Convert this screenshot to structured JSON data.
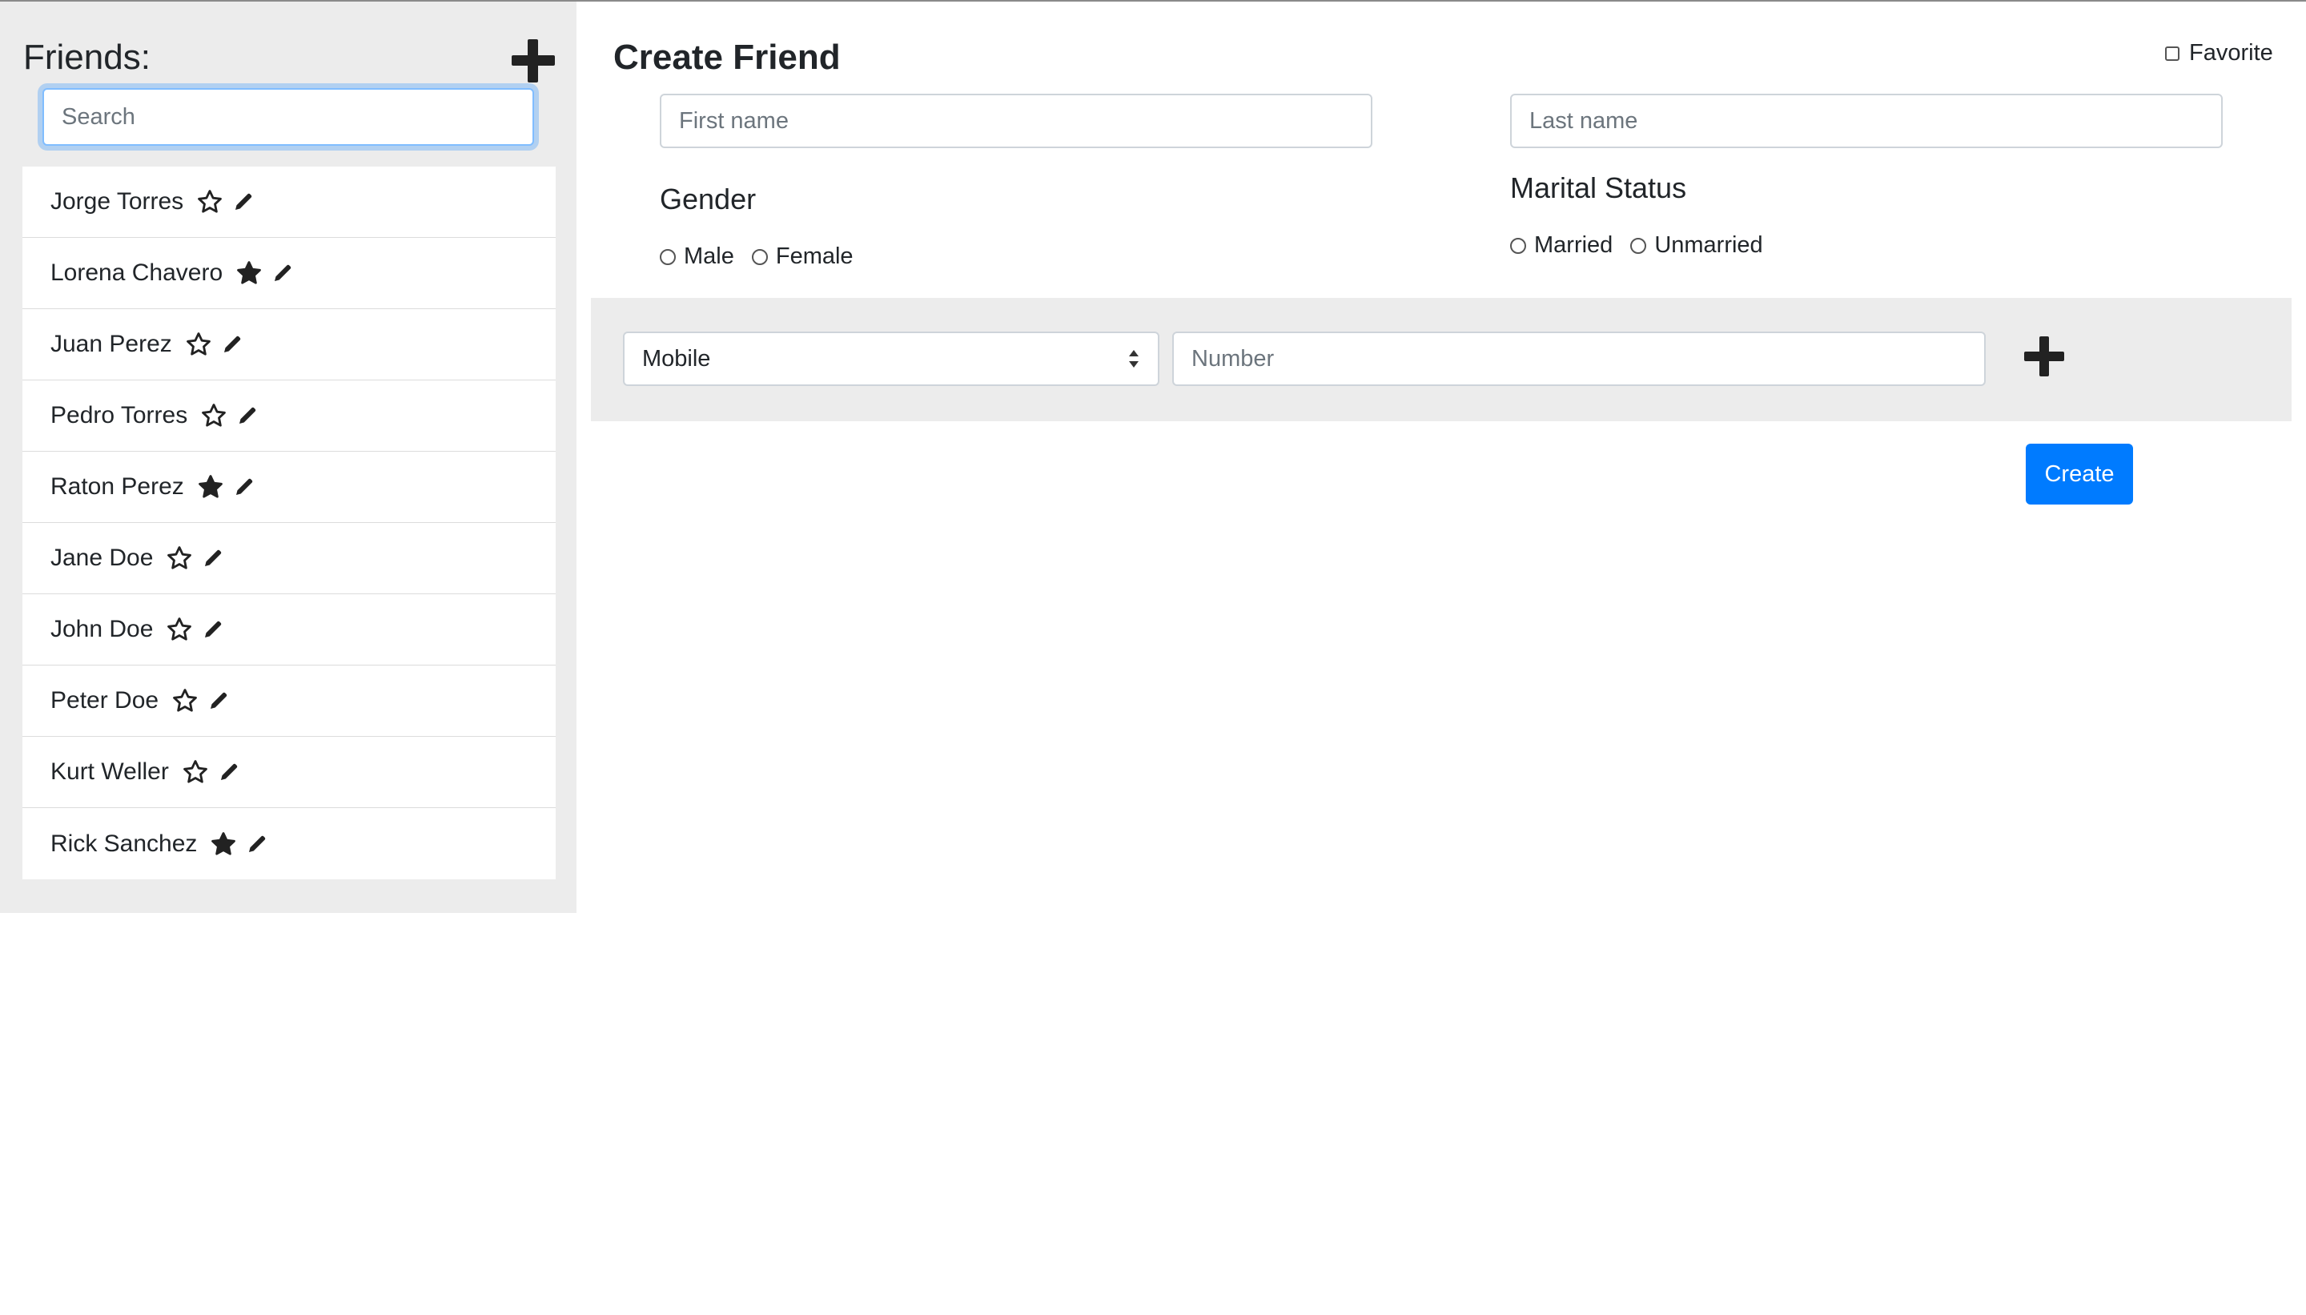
{
  "sidebar": {
    "title": "Friends:",
    "add_icon": "plus-icon",
    "search": {
      "placeholder": "Search",
      "value": ""
    },
    "friends": [
      {
        "name": "Jorge Torres",
        "favorite": false
      },
      {
        "name": "Lorena Chavero",
        "favorite": true
      },
      {
        "name": "Juan Perez",
        "favorite": false
      },
      {
        "name": "Pedro Torres",
        "favorite": false
      },
      {
        "name": "Raton Perez",
        "favorite": true
      },
      {
        "name": "Jane Doe",
        "favorite": false
      },
      {
        "name": "John Doe",
        "favorite": false
      },
      {
        "name": "Peter Doe",
        "favorite": false
      },
      {
        "name": "Kurt Weller",
        "favorite": false
      },
      {
        "name": "Rick Sanchez",
        "favorite": true
      }
    ]
  },
  "main": {
    "title": "Create Friend",
    "favorite_label": "Favorite",
    "first_name": {
      "placeholder": "First name",
      "value": ""
    },
    "last_name": {
      "placeholder": "Last name",
      "value": ""
    },
    "gender": {
      "label": "Gender",
      "options": [
        "Male",
        "Female"
      ]
    },
    "marital_status": {
      "label": "Marital Status",
      "options": [
        "Married",
        "Unmarried"
      ]
    },
    "phone": {
      "type_selected": "Mobile",
      "number": {
        "placeholder": "Number",
        "value": ""
      },
      "add_icon": "plus-icon"
    },
    "create_label": "Create"
  },
  "colors": {
    "primary": "#007bff",
    "panel_bg": "#ececec",
    "text": "#212529",
    "focus_ring": "#80bdff"
  }
}
